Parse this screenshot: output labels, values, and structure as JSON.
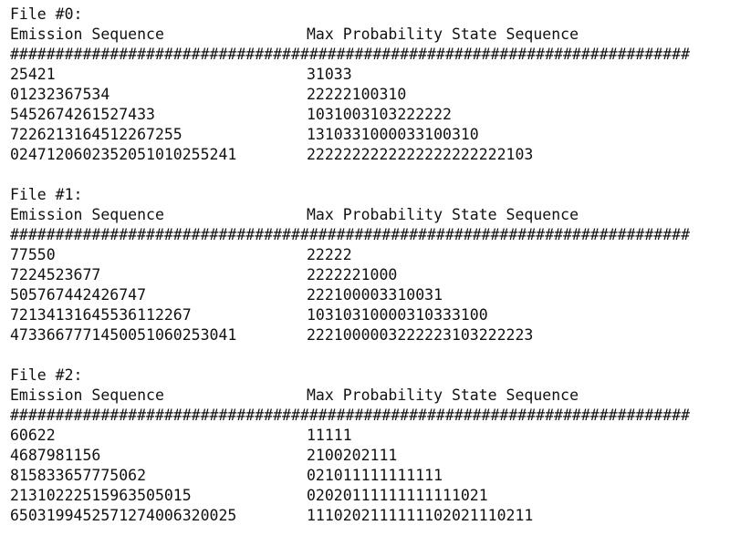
{
  "files": [
    {
      "title": "File #0:",
      "header_left": "Emission Sequence",
      "header_right": "Max Probability State Sequence",
      "separator": "###########################################################################",
      "rows": [
        {
          "emission": "25421",
          "state": "31033"
        },
        {
          "emission": "01232367534",
          "state": "22222100310"
        },
        {
          "emission": "5452674261527433",
          "state": "1031003103222222"
        },
        {
          "emission": "7226213164512267255",
          "state": "1310331000033100310"
        },
        {
          "emission": "024712060235205101025524l",
          "state": "2222222222222222222222103"
        }
      ]
    },
    {
      "title": "File #1:",
      "header_left": "Emission Sequence",
      "header_right": "Max Probability State Sequence",
      "separator": "###########################################################################",
      "rows": [
        {
          "emission": "77550",
          "state": "22222"
        },
        {
          "emission": "7224523677",
          "state": "2222221000"
        },
        {
          "emission": "505767442426747",
          "state": "222100003310031"
        },
        {
          "emission": "7213413164553611226 7",
          "state": "103103100003103331 00"
        },
        {
          "emission": "4733667771450051060253041",
          "state": "2221000003222223103222223"
        }
      ]
    },
    {
      "title": "File #2:",
      "header_left": "Emission Sequence",
      "header_right": "Max Probability State Sequence",
      "separator": "###########################################################################",
      "rows": [
        {
          "emission": "60622",
          "state": "11111"
        },
        {
          "emission": "4687981156",
          "state": "2100202111"
        },
        {
          "emission": "815833657775062",
          "state": "021011111111111"
        },
        {
          "emission": "21310222515963505015",
          "state": "02020111111111111021"
        },
        {
          "emission": "6503199452571274006320025",
          "state": "1110202111111102021110211"
        }
      ]
    }
  ]
}
